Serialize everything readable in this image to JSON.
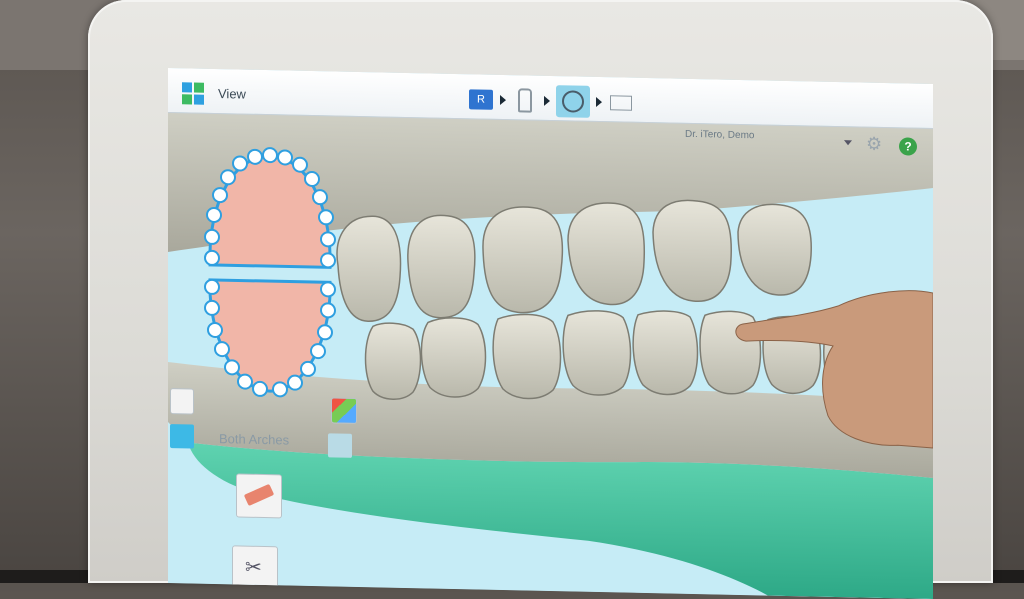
{
  "topbar": {
    "title": "View",
    "steps": [
      "rx-icon",
      "scan-icon",
      "view-icon",
      "send-icon"
    ],
    "active_step": 2,
    "doctor_name": "Dr. iTero, Demo"
  },
  "left_panel": {
    "arch_label": "Both Arches",
    "tools": [
      "eraser-tool",
      "scissors-tool"
    ]
  },
  "colors": {
    "accent": "#3db9e6",
    "gum": "#4fc6a5",
    "teeth": "#d9d8cc",
    "help": "#3aa34a"
  }
}
